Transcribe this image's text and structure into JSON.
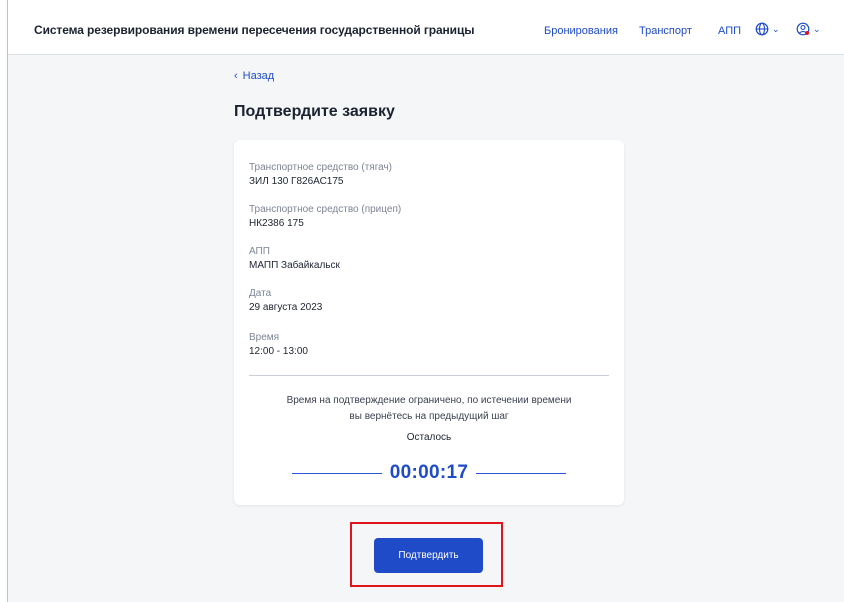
{
  "header": {
    "app_title": "Система резервирования времени пересечения государственной границы",
    "nav": {
      "bookings": "Бронирования",
      "transport": "Транспорт",
      "checkpoint": "АПП"
    },
    "icons": {
      "language": "globe-icon",
      "user": "user-circle-icon",
      "dropdown": "chevron-down-icon"
    }
  },
  "back_link": {
    "arrow": "‹",
    "label": "Назад"
  },
  "page_title": "Подтвердите заявку",
  "details": [
    {
      "label": "Транспортное средство (тягач)",
      "value": "ЗИЛ 130 Г826АС175"
    },
    {
      "label": "Транспортное средство (прицеп)",
      "value": "НК2386 175"
    },
    {
      "label": "АПП",
      "value": "МАПП Забайкальск"
    },
    {
      "label": "Дата",
      "value": "29 августа 2023"
    },
    {
      "label": "Время",
      "value": "12:00 - 13:00"
    }
  ],
  "notice": {
    "line1": "Время на подтверждение ограничено, по истечении времени",
    "line2": "вы вернётесь на предыдущий шаг",
    "remaining_label": "Осталось",
    "timer": "00:00:17"
  },
  "confirm_button": "Подтвердить",
  "colors": {
    "accent": "#1f4bc9",
    "highlight": "#e0151c",
    "background": "#f4f6f8"
  }
}
